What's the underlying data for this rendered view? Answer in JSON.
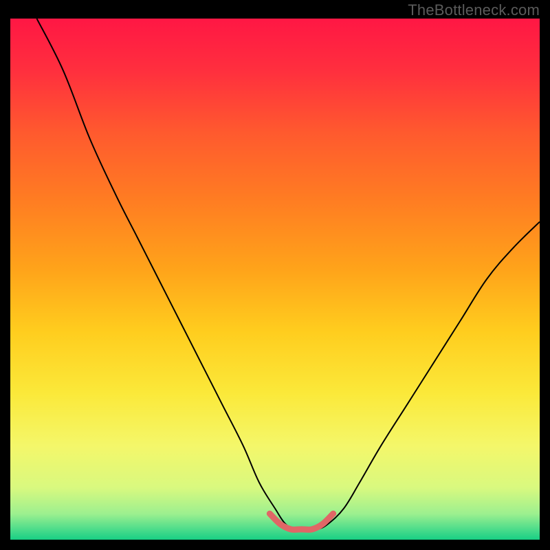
{
  "watermark": "TheBottleneck.com",
  "colors": {
    "gradient_stops": [
      {
        "offset": 0.0,
        "color": "#ff1744"
      },
      {
        "offset": 0.1,
        "color": "#ff2f3e"
      },
      {
        "offset": 0.22,
        "color": "#ff5a2e"
      },
      {
        "offset": 0.35,
        "color": "#ff7d22"
      },
      {
        "offset": 0.48,
        "color": "#ffa31a"
      },
      {
        "offset": 0.6,
        "color": "#ffcd1e"
      },
      {
        "offset": 0.72,
        "color": "#fbe93a"
      },
      {
        "offset": 0.82,
        "color": "#f4f76a"
      },
      {
        "offset": 0.9,
        "color": "#d9f97f"
      },
      {
        "offset": 0.95,
        "color": "#9df08f"
      },
      {
        "offset": 0.985,
        "color": "#3fd98a"
      },
      {
        "offset": 1.0,
        "color": "#18cf84"
      }
    ],
    "curve": "#000000",
    "salmon": "#e06666",
    "frame": "#000000"
  },
  "chart_data": {
    "type": "line",
    "title": "",
    "xlabel": "",
    "ylabel": "",
    "xlim": [
      0,
      100
    ],
    "ylim": [
      0,
      100
    ],
    "series": [
      {
        "name": "bottleneck-curve",
        "x": [
          5,
          10,
          15,
          20,
          24,
          28,
          32,
          36,
          40,
          44,
          47,
          50,
          52,
          54,
          56,
          58,
          60,
          63,
          66,
          70,
          75,
          80,
          85,
          90,
          95,
          100
        ],
        "y": [
          100,
          90,
          77,
          66,
          58,
          50,
          42,
          34,
          26,
          18,
          11,
          6,
          3,
          2,
          2,
          2,
          3,
          6,
          11,
          18,
          26,
          34,
          42,
          50,
          56,
          61
        ]
      }
    ],
    "highlight_segment": {
      "name": "optimal-range",
      "x": [
        49,
        51,
        53,
        55,
        57,
        59,
        61
      ],
      "y": [
        5,
        3,
        2,
        2,
        2,
        3,
        5
      ]
    }
  }
}
